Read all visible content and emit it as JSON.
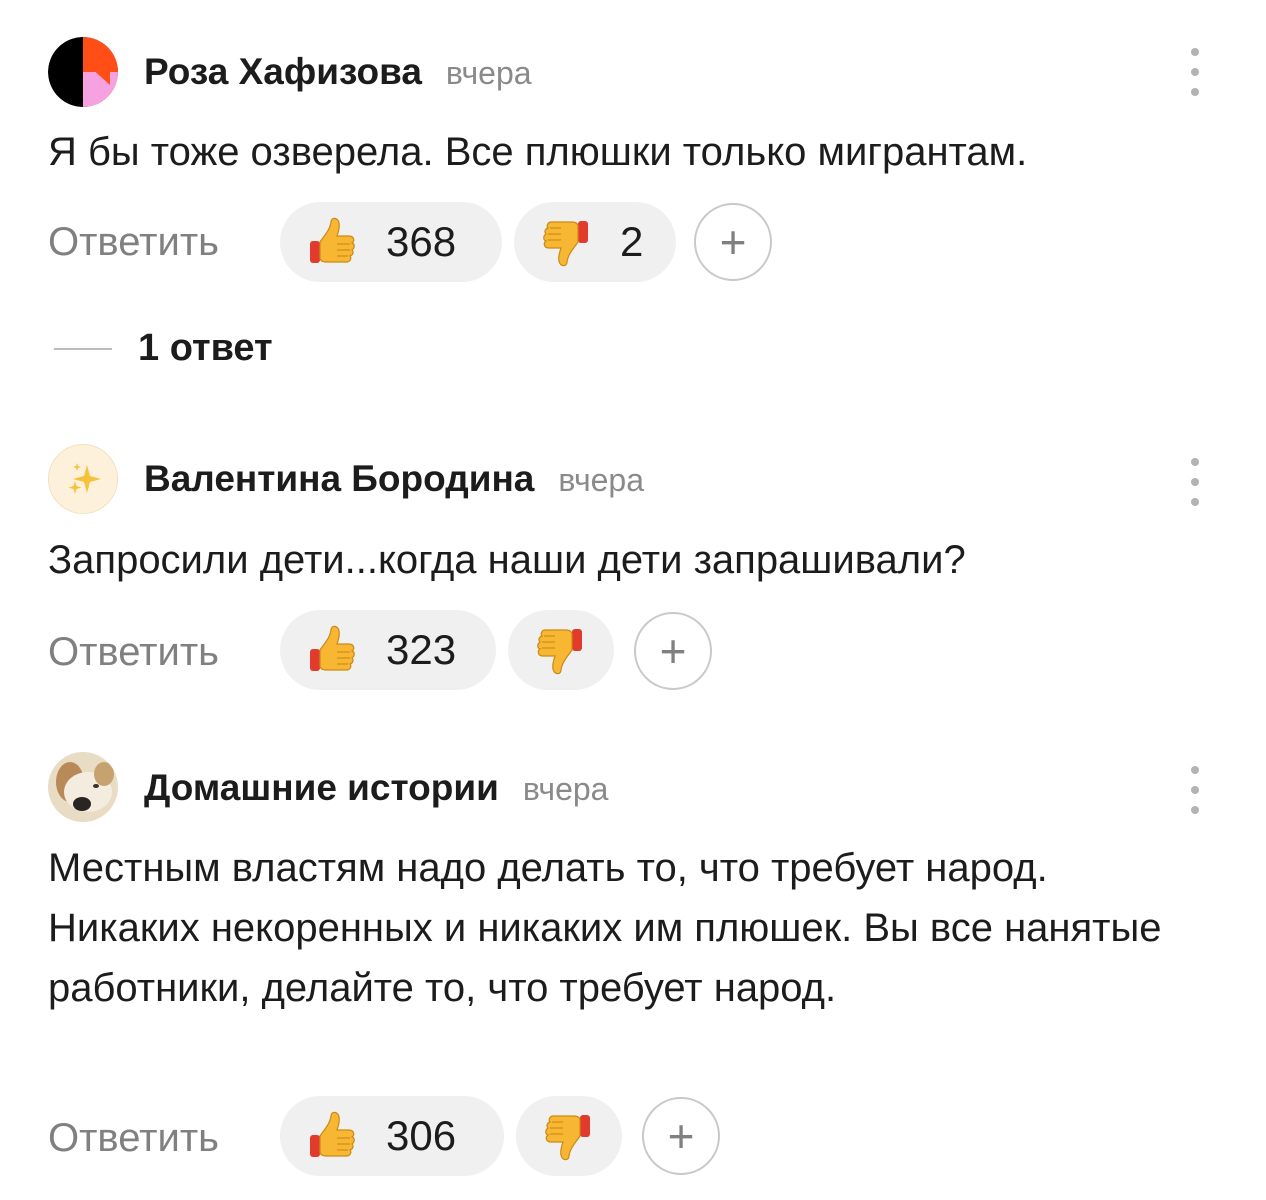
{
  "comments": [
    {
      "author": "Роза Хафизова",
      "date": "вчера",
      "text": "Я бы тоже озверела. Все плюшки только мигрантам.",
      "reply_label": "Ответить",
      "likes": "368",
      "dislikes": "2",
      "add_label": "+"
    },
    {
      "author": "Валентина Бородина",
      "date": "вчера",
      "text": "Запросили дети...когда наши дети запрашивали?",
      "reply_label": "Ответить",
      "likes": "323",
      "dislikes": "",
      "add_label": "+"
    },
    {
      "author": "Домашние истории",
      "date": "вчера",
      "text": "Местным властям надо делать то, что требует народ. Никаких некоренных и никаких им плюшек. Вы все нанятые работники, делайте то, что требует народ.",
      "reply_label": "Ответить",
      "likes": "306",
      "dislikes": "",
      "add_label": "+"
    }
  ],
  "thread": {
    "replies_label": "1 ответ"
  },
  "icons": {
    "like": "thumbs-up-emoji",
    "dislike": "thumbs-down-emoji",
    "menu": "vertical-dots-icon",
    "avatar_2": "sparkles-emoji"
  },
  "colors": {
    "avatar_1_orange": "#ff4f17",
    "avatar_1_pink": "#f6a2e0",
    "avatar_2_bg": "#fdf1dc"
  }
}
